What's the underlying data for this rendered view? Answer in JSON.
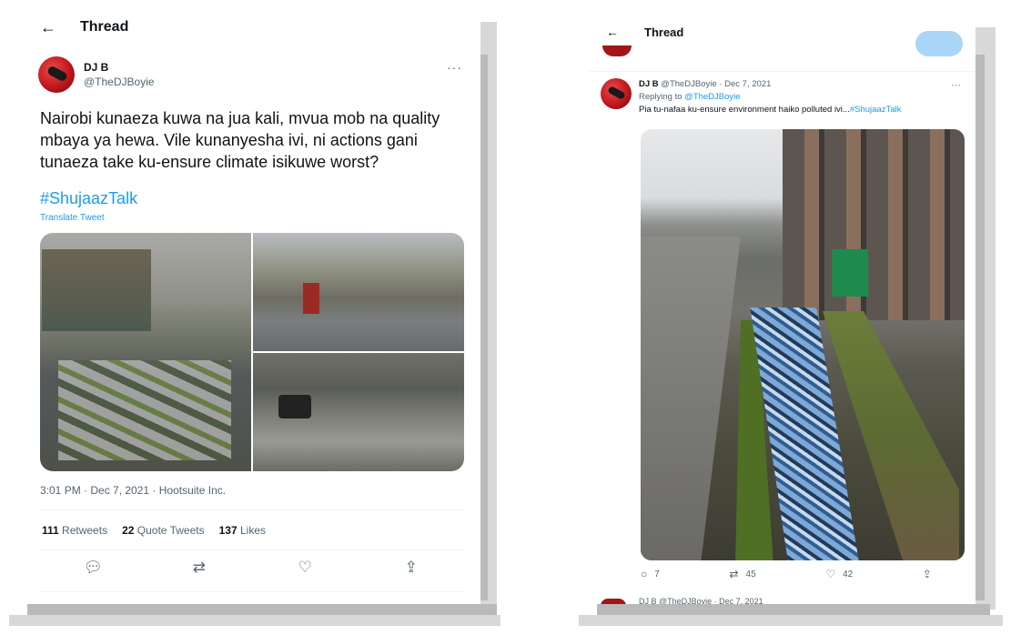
{
  "left_card": {
    "header": {
      "back_icon": "←",
      "title": "Thread"
    },
    "author": {
      "display_name": "DJ B",
      "handle": "@TheDJBoyie",
      "more": "···"
    },
    "tweet": {
      "text": "Nairobi kunaeza kuwa na jua kali, mvua mob na quality mbaya ya hewa. Vile kunanyesha ivi, ni actions gani tunaeza take ku-ensure climate isikuwe worst?",
      "hashtag": "#ShujaazTalk",
      "translate": "Translate Tweet"
    },
    "meta": {
      "timestamp": "3:01 PM · Dec 7, 2021 · Hootsuite Inc."
    },
    "stats": [
      {
        "count": "111",
        "label": "Retweets"
      },
      {
        "count": "22",
        "label": "Quote Tweets"
      },
      {
        "count": "137",
        "label": "Likes"
      }
    ],
    "actions": [
      {
        "icon": "reply-icon",
        "glyph": "💬︎"
      },
      {
        "icon": "retweet-icon",
        "glyph": "⇄"
      },
      {
        "icon": "like-icon",
        "glyph": "♡"
      },
      {
        "icon": "share-icon",
        "glyph": "⇪"
      }
    ]
  },
  "right_card": {
    "header": {
      "back_icon": "←",
      "title": "Thread"
    },
    "reply": {
      "display_name": "DJ B",
      "handle_date": "@TheDJBoyie · Dec 7, 2021",
      "replying_prefix": "Replying to",
      "replying_handle": "@TheDJBoyie",
      "text": "Pia tu-nafaa ku-ensure environment haiko polluted ivi...",
      "hashtag": "#ShujaazTalk",
      "more": "···"
    },
    "actions": [
      {
        "icon": "reply-icon",
        "glyph": "○",
        "count": "7"
      },
      {
        "icon": "retweet-icon",
        "glyph": "⇄",
        "count": "45"
      },
      {
        "icon": "like-icon",
        "glyph": "♡",
        "count": "42"
      },
      {
        "icon": "share-icon",
        "glyph": "⇪",
        "count": ""
      }
    ],
    "next_peek": "DJ B @TheDJBoyie · Dec 7, 2021"
  },
  "colors": {
    "link": "#1d9bf0",
    "text": "#0f1419",
    "muted": "#536471",
    "avatar": "#c0161c"
  }
}
